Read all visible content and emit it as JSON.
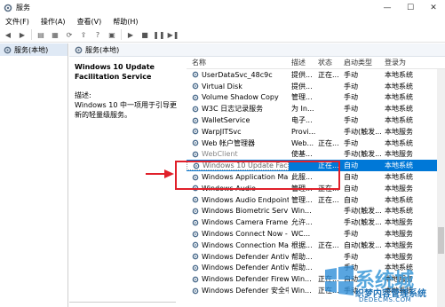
{
  "window": {
    "title": "服务"
  },
  "menu": [
    "文件(F)",
    "操作(A)",
    "查看(V)",
    "帮助(H)"
  ],
  "tree": {
    "item": "服务(本地)"
  },
  "services_bar": {
    "title": "服务(本地)"
  },
  "description": {
    "service_name": "Windows 10 Update Facilitation Service",
    "label": "描述:",
    "text": "Windows 10 中一项用于引导更新的轻量级服务。"
  },
  "table": {
    "headers": [
      "名称",
      "描述",
      "状态",
      "启动类型",
      "登录为"
    ],
    "rows": [
      {
        "name": "UserDataSvc_48c9c",
        "desc": "提供...",
        "status": "正在...",
        "startup": "手动",
        "logon": "本地系统"
      },
      {
        "name": "Virtual Disk",
        "desc": "提供...",
        "status": "",
        "startup": "手动",
        "logon": "本地系统"
      },
      {
        "name": "Volume Shadow Copy",
        "desc": "管理...",
        "status": "",
        "startup": "手动",
        "logon": "本地系统"
      },
      {
        "name": "W3C 日志记录服务",
        "desc": "为 In...",
        "status": "",
        "startup": "手动",
        "logon": "本地系统"
      },
      {
        "name": "WalletService",
        "desc": "电子...",
        "status": "",
        "startup": "手动",
        "logon": "本地系统"
      },
      {
        "name": "WarpJITSvc",
        "desc": "Provi...",
        "status": "",
        "startup": "手动(触发...",
        "logon": "本地服务"
      },
      {
        "name": "Web 帐户管理器",
        "desc": "Web...",
        "status": "正在...",
        "startup": "手动",
        "logon": "本地系统"
      },
      {
        "name": "WebClient",
        "desc": "使基...",
        "status": "",
        "startup": "手动(触发...",
        "logon": "本地服务"
      },
      {
        "name": "Windows 10 Update Facilitation Service",
        "desc": "",
        "status": "正在...",
        "startup": "自动",
        "logon": "本地系统",
        "selected": true
      },
      {
        "name": "Windows Application Mana...",
        "desc": "此服...",
        "status": "",
        "startup": "自动",
        "logon": "本地系统"
      },
      {
        "name": "Windows Audio",
        "desc": "管理...",
        "status": "正在...",
        "startup": "自动",
        "logon": "本地服务"
      },
      {
        "name": "Windows Audio Endpoint B...",
        "desc": "管理...",
        "status": "正在...",
        "startup": "自动",
        "logon": "本地系统"
      },
      {
        "name": "Windows Biometric Service",
        "desc": "Win...",
        "status": "",
        "startup": "手动(触发...",
        "logon": "本地系统"
      },
      {
        "name": "Windows Camera Frame S...",
        "desc": "允许...",
        "status": "",
        "startup": "手动(触发...",
        "logon": "本地服务"
      },
      {
        "name": "Windows Connect Now - C...",
        "desc": "WC...",
        "status": "",
        "startup": "手动",
        "logon": "本地服务"
      },
      {
        "name": "Windows Connection Man...",
        "desc": "根据...",
        "status": "正在...",
        "startup": "自动(触发...",
        "logon": "本地服务"
      },
      {
        "name": "Windows Defender Antivir...",
        "desc": "帮助...",
        "status": "",
        "startup": "手动",
        "logon": "本地服务"
      },
      {
        "name": "Windows Defender Antivir...",
        "desc": "帮助...",
        "status": "",
        "startup": "手动",
        "logon": "本地系统"
      },
      {
        "name": "Windows Defender Firewall",
        "desc": "Win...",
        "status": "正在...",
        "startup": "自动",
        "logon": "本地服务"
      },
      {
        "name": "Windows Defender 安全中...",
        "desc": "Win...",
        "status": "正在...",
        "startup": "手动",
        "logon": "本地系统"
      }
    ]
  },
  "watermark": {
    "brand": "系统城",
    "site": "织梦内容管理系统",
    "url": "DEDECMS.COM"
  },
  "colors": {
    "selection": "#0078d7",
    "highlight_box": "#e0202a",
    "tree_selected": "#dfe9f5"
  }
}
